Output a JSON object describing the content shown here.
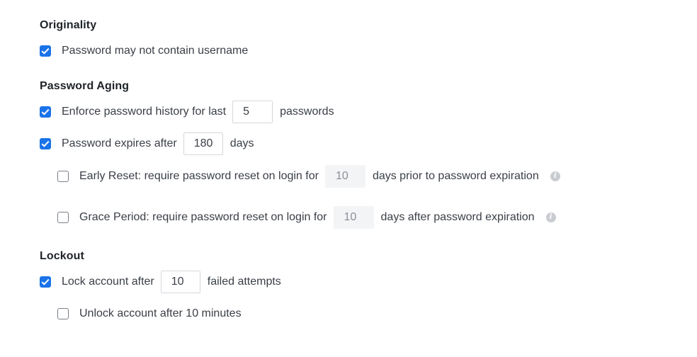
{
  "originality": {
    "title": "Originality",
    "no_username": {
      "checked": true,
      "label": "Password may not contain username"
    }
  },
  "aging": {
    "title": "Password Aging",
    "history": {
      "checked": true,
      "label": "Enforce password history for last",
      "value": "5",
      "suffix": "passwords"
    },
    "expires": {
      "checked": true,
      "label": "Password expires after",
      "value": "180",
      "suffix": "days"
    },
    "early_reset": {
      "checked": false,
      "label": "Early Reset: require password reset on login for",
      "value": "10",
      "suffix": "days prior to password expiration",
      "info_icon": "info-icon"
    },
    "grace_period": {
      "checked": false,
      "label": "Grace Period: require password reset on login for",
      "value": "10",
      "suffix": "days after password expiration",
      "info_icon": "info-icon"
    }
  },
  "lockout": {
    "title": "Lockout",
    "lock_after": {
      "checked": true,
      "label": "Lock account after",
      "value": "10",
      "suffix": "failed attempts"
    },
    "unlock_after": {
      "checked": false,
      "label": "Unlock account after 10 minutes"
    }
  },
  "colors": {
    "accent": "#1a73e8",
    "disabled_input_bg": "#f3f4f6",
    "info_icon": "#c9ccd1"
  }
}
